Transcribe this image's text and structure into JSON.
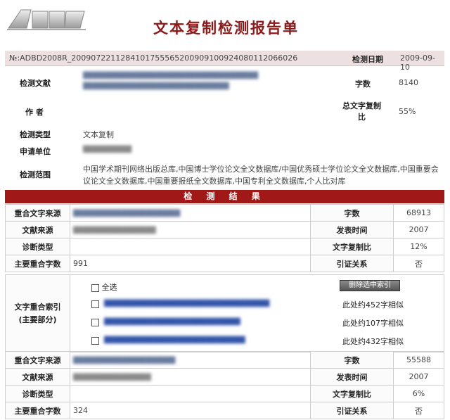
{
  "header": {
    "title": "文本复制检测报告单"
  },
  "report": {
    "number": "№:ADBD2008R_2009072211284101755565200909100924080112066026",
    "date_label": "检测日期",
    "date": "2009-09-10"
  },
  "info": {
    "doc_label": "检测文献",
    "author_label": "作 者",
    "words_label": "字数",
    "words": "8140",
    "total_copy_label_line1": "总文字复制",
    "total_copy_label_line2": "比",
    "total_copy": "55%",
    "type_label": "检测类型",
    "type": "文本复制",
    "unit_label": "申请单位",
    "scope_label": "检测范围",
    "scope": "中国学术期刊网络出版总库,中国博士学位论文全文数据库/中国优秀硕士学位论文全文数据库,中国重要会议论文全文数据库,中国重要报纸全文数据库,中国专利全文数据库,个人比对库"
  },
  "results": {
    "bar_title": "检 测 结 果",
    "source1": {
      "source_label": "重合文字来源",
      "words_label": "字数",
      "words": "68913",
      "origin_label": "文献来源",
      "pubtime_label": "发表时间",
      "pubtime": "2007",
      "diag_label": "诊断类型",
      "ratio_label": "文字复制比",
      "ratio": "12%",
      "main_count_label": "主要重合字数",
      "main_count": "991",
      "cite_label": "引证关系",
      "cite": "否"
    },
    "index": {
      "label_line1": "文字重合索引",
      "label_line2": "(主要部分)",
      "select_all": "全选",
      "delete_button": "删除选中索引",
      "items": [
        {
          "similar": "此处约452字相似"
        },
        {
          "similar": "此处约107字相似"
        },
        {
          "similar": "此处约432字相似"
        }
      ]
    },
    "source2": {
      "source_label": "重合文字来源",
      "words_label": "字数",
      "words": "55588",
      "origin_label": "文献来源",
      "pubtime_label": "发表时间",
      "pubtime": "2007",
      "diag_label": "诊断类型",
      "ratio_label": "文字复制比",
      "ratio": "6%",
      "main_count_label": "主要重合字数",
      "main_count": "324",
      "cite_label": "引证关系",
      "cite": "否"
    }
  }
}
